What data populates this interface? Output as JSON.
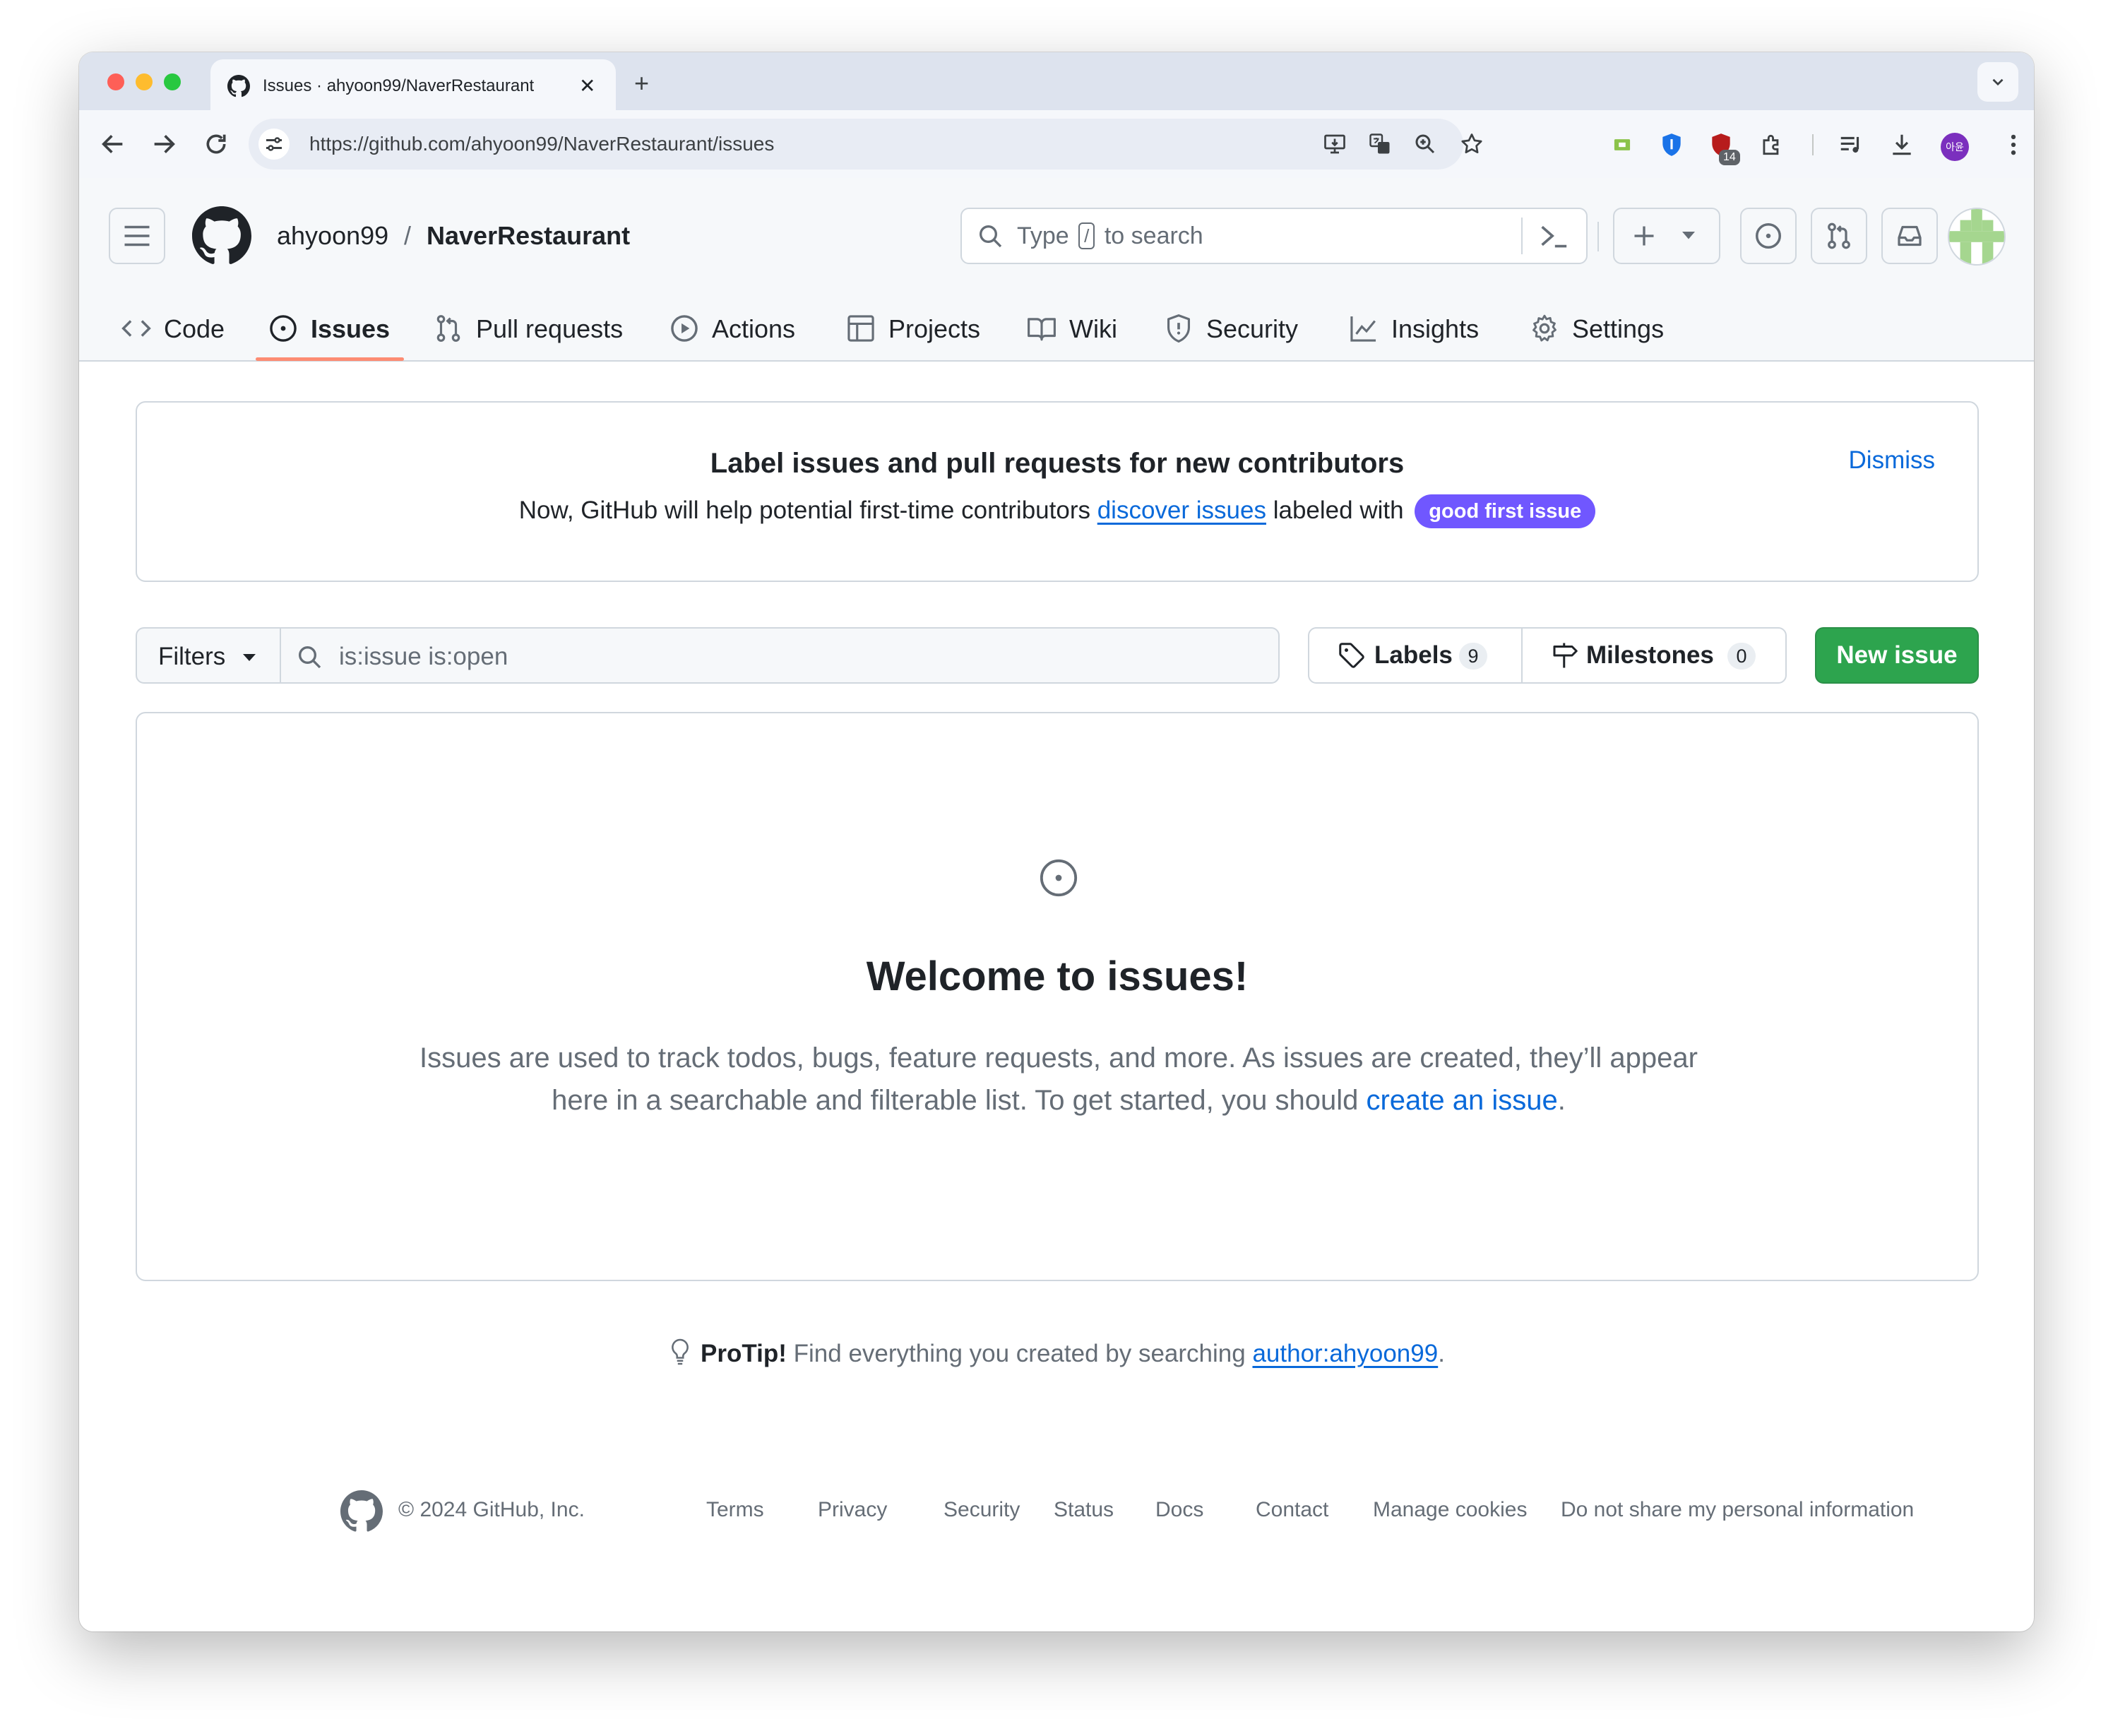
{
  "browser": {
    "tab_title": "Issues · ahyoon99/NaverRestaurant",
    "tab_close": "✕",
    "new_tab": "+",
    "tab_search": "⌄",
    "url": "https://github.com/ahyoon99/NaverRestaurant/issues",
    "extension_badge": "14",
    "profile_initials": "아윤"
  },
  "header": {
    "owner": "ahyoon99",
    "separator": "/",
    "repo": "NaverRestaurant",
    "search_prefix": "Type",
    "search_key": "/",
    "search_suffix": "to search"
  },
  "repo_nav": {
    "items": [
      {
        "label": "Code",
        "icon": "code-icon"
      },
      {
        "label": "Issues",
        "icon": "issue-opened-icon",
        "active": true
      },
      {
        "label": "Pull requests",
        "icon": "git-pull-request-icon"
      },
      {
        "label": "Actions",
        "icon": "play-icon"
      },
      {
        "label": "Projects",
        "icon": "table-icon"
      },
      {
        "label": "Wiki",
        "icon": "book-icon"
      },
      {
        "label": "Security",
        "icon": "shield-icon"
      },
      {
        "label": "Insights",
        "icon": "graph-icon"
      },
      {
        "label": "Settings",
        "icon": "gear-icon"
      }
    ]
  },
  "banner": {
    "title": "Label issues and pull requests for new contributors",
    "body_prefix": "Now, GitHub will help potential first-time contributors",
    "body_link": "discover issues",
    "body_middle": "labeled with",
    "label": "good first issue",
    "dismiss": "Dismiss"
  },
  "filter_bar": {
    "filters_label": "Filters",
    "query": "is:issue is:open",
    "labels_label": "Labels",
    "labels_count": "9",
    "milestones_label": "Milestones",
    "milestones_count": "0",
    "new_issue_label": "New issue"
  },
  "blank_slate": {
    "title": "Welcome to issues!",
    "body": "Issues are used to track todos, bugs, feature requests, and more. As issues are created, they’ll appear here in a searchable and filterable list. To get started, you should",
    "link": "create an issue",
    "end": "."
  },
  "protip": {
    "bold": "ProTip!",
    "text": "Find everything you created by searching",
    "link": "author:ahyoon99",
    "end": "."
  },
  "footer": {
    "copyright": "© 2024 GitHub, Inc.",
    "links": [
      "Terms",
      "Privacy",
      "Security",
      "Status",
      "Docs",
      "Contact",
      "Manage cookies",
      "Do not share my personal information"
    ]
  },
  "colors": {
    "accent_link": "#0969da",
    "primary_button": "#2da44e",
    "label_good_first_issue": "#7057ff",
    "active_tab_underline": "#fd8c73"
  }
}
